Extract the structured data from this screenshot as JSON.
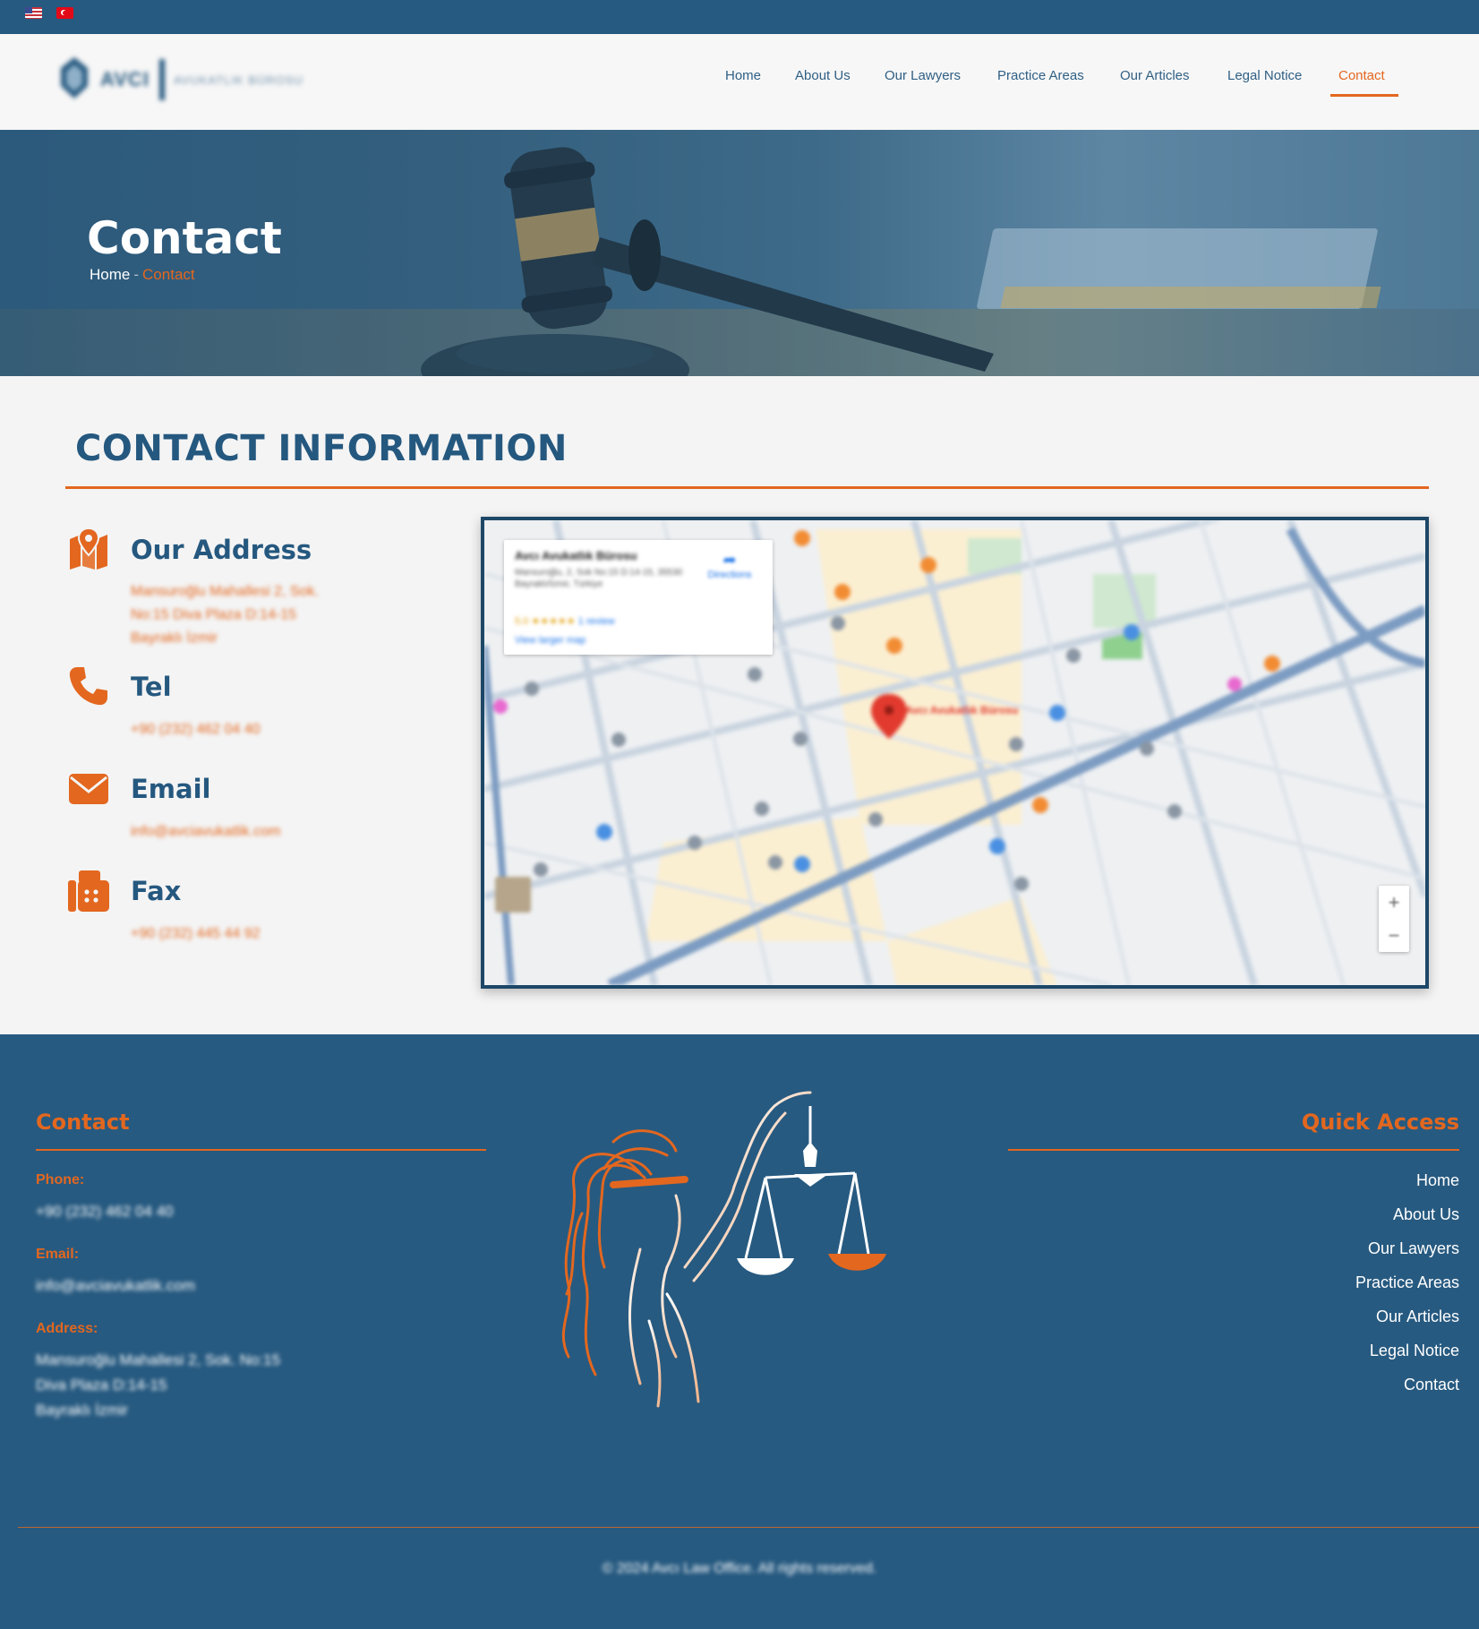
{
  "topbar": {
    "languages": [
      {
        "code": "en",
        "icon": "us-flag-icon"
      },
      {
        "code": "tr",
        "icon": "turkey-flag-icon"
      }
    ]
  },
  "header": {
    "logo": {
      "brand": "AVCI",
      "subtitle": "AVUKATLIK BÜROSU"
    },
    "nav": [
      {
        "label": "Home",
        "active": false
      },
      {
        "label": "About Us",
        "active": false
      },
      {
        "label": "Our Lawyers",
        "active": false
      },
      {
        "label": "Practice Areas",
        "active": false
      },
      {
        "label": "Our Articles",
        "active": false
      },
      {
        "label": "Legal Notice",
        "active": false
      },
      {
        "label": "Contact",
        "active": true
      }
    ]
  },
  "hero": {
    "title": "Contact",
    "breadcrumb": {
      "home": "Home",
      "separator": "-",
      "current": "Contact"
    }
  },
  "contact_info": {
    "heading": "CONTACT INFORMATION",
    "items": [
      {
        "icon": "map-icon",
        "label": "Our Address",
        "lines": [
          "Mansuroğlu Mahallesi 2, Sok.",
          "No:15 Diva Plaza D:14-15",
          "Bayraklı İzmir"
        ]
      },
      {
        "icon": "phone-icon",
        "label": "Tel",
        "lines": [
          "+90 (232) 462 04 40"
        ]
      },
      {
        "icon": "envelope-icon",
        "label": "Email",
        "lines": [
          "info@avciavukatlik.com"
        ]
      },
      {
        "icon": "fax-icon",
        "label": "Fax",
        "lines": [
          "+90 (232) 445 44 92"
        ]
      }
    ]
  },
  "map": {
    "card_title": "Avcı Avukatlık Bürosu",
    "card_address": "Mansuroğlu, 2, Sok No:15 D:14-15, 35530 Bayraklı/İzmir, Türkiye",
    "rating": "5.0 ★★★★★",
    "reviews": "1 review",
    "view_larger": "View larger map",
    "directions": "Directions",
    "pin_label": "Avcı Avukatlık Bürosu",
    "zoom_in": "+",
    "zoom_out": "−"
  },
  "footer": {
    "contact_heading": "Contact",
    "phone_label": "Phone:",
    "phone": "+90 (232) 462 04 40",
    "email_label": "Email:",
    "email": "info@avciavukatlik.com",
    "address_label": "Address:",
    "address_lines": [
      "Mansuroğlu Mahallesi 2, Sok. No:15",
      "Diva Plaza D:14-15",
      "Bayraklı İzmir"
    ],
    "quick_heading": "Quick Access",
    "quick_links": [
      "Home",
      "About Us",
      "Our Lawyers",
      "Practice Areas",
      "Our Articles",
      "Legal Notice",
      "Contact"
    ],
    "copyright": "© 2024 Avcı Law Office. All rights reserved."
  },
  "colors": {
    "primary": "#275a80",
    "accent": "#e3671f",
    "background": "#f4f4f4"
  }
}
